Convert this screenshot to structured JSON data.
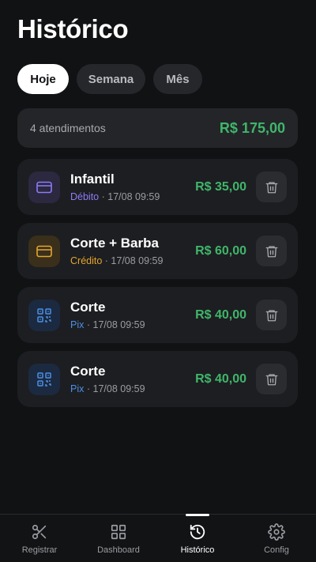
{
  "page": {
    "title": "Histórico"
  },
  "filters": [
    {
      "label": "Hoje",
      "active": true
    },
    {
      "label": "Semana",
      "active": false
    },
    {
      "label": "Mês",
      "active": false
    }
  ],
  "summary": {
    "count_text": "4 atendimentos",
    "total": "R$ 175,00"
  },
  "transactions": [
    {
      "service": "Infantil",
      "method": "Débito",
      "datetime": "· 17/08 09:59",
      "amount": "R$ 35,00",
      "icon": "card-icon",
      "color": "#8b7cf6"
    },
    {
      "service": "Corte + Barba",
      "method": "Crédito",
      "datetime": "· 17/08 09:59",
      "amount": "R$ 60,00",
      "icon": "card-icon",
      "color": "#e3a62f"
    },
    {
      "service": "Corte",
      "method": "Pix",
      "datetime": "· 17/08 09:59",
      "amount": "R$ 40,00",
      "icon": "qr-code-icon",
      "color": "#4c8fe6"
    },
    {
      "service": "Corte",
      "method": "Pix",
      "datetime": "· 17/08 09:59",
      "amount": "R$ 40,00",
      "icon": "qr-code-icon",
      "color": "#4c8fe6"
    }
  ],
  "nav": [
    {
      "label": "Registrar",
      "icon": "scissors-icon",
      "active": false
    },
    {
      "label": "Dashboard",
      "icon": "grid-icon",
      "active": false
    },
    {
      "label": "Histórico",
      "icon": "history-icon",
      "active": true
    },
    {
      "label": "Config",
      "icon": "gear-icon",
      "active": false
    }
  ],
  "colors": {
    "accent_green": "#3fb66b",
    "background": "#111214"
  }
}
